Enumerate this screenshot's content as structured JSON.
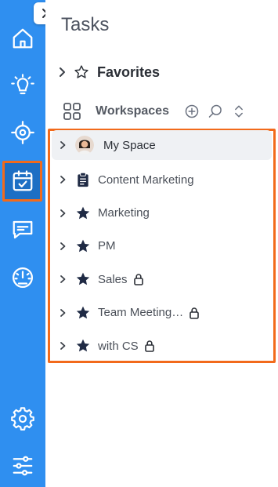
{
  "colors": {
    "rail": "#2f8ff0",
    "highlight": "#f26a1b",
    "star": "#1f2a44"
  },
  "rail": {
    "items": [
      {
        "name": "home",
        "icon": "home-icon"
      },
      {
        "name": "ideas",
        "icon": "lightbulb-icon"
      },
      {
        "name": "goals",
        "icon": "target-icon"
      },
      {
        "name": "tasks",
        "icon": "calendar-check-icon",
        "active": true
      },
      {
        "name": "chat",
        "icon": "chat-icon"
      },
      {
        "name": "dashboards",
        "icon": "gauge-icon"
      },
      {
        "name": "settings",
        "icon": "gear-icon"
      },
      {
        "name": "filters",
        "icon": "sliders-icon"
      }
    ]
  },
  "panel": {
    "title": "Tasks",
    "favorites_label": "Favorites",
    "workspaces_label": "Workspaces"
  },
  "workspaces": [
    {
      "name": "My Space",
      "icon": "avatar",
      "locked": false,
      "selected": true
    },
    {
      "name": "Content Marketing",
      "icon": "clipboard-icon",
      "locked": false
    },
    {
      "name": "Marketing",
      "icon": "star-icon",
      "locked": false
    },
    {
      "name": "PM",
      "icon": "star-icon",
      "locked": false
    },
    {
      "name": "Sales",
      "icon": "star-icon",
      "locked": true
    },
    {
      "name": "Team Meeting…",
      "icon": "star-icon",
      "locked": true
    },
    {
      "name": "with CS",
      "icon": "star-icon",
      "locked": true
    }
  ]
}
